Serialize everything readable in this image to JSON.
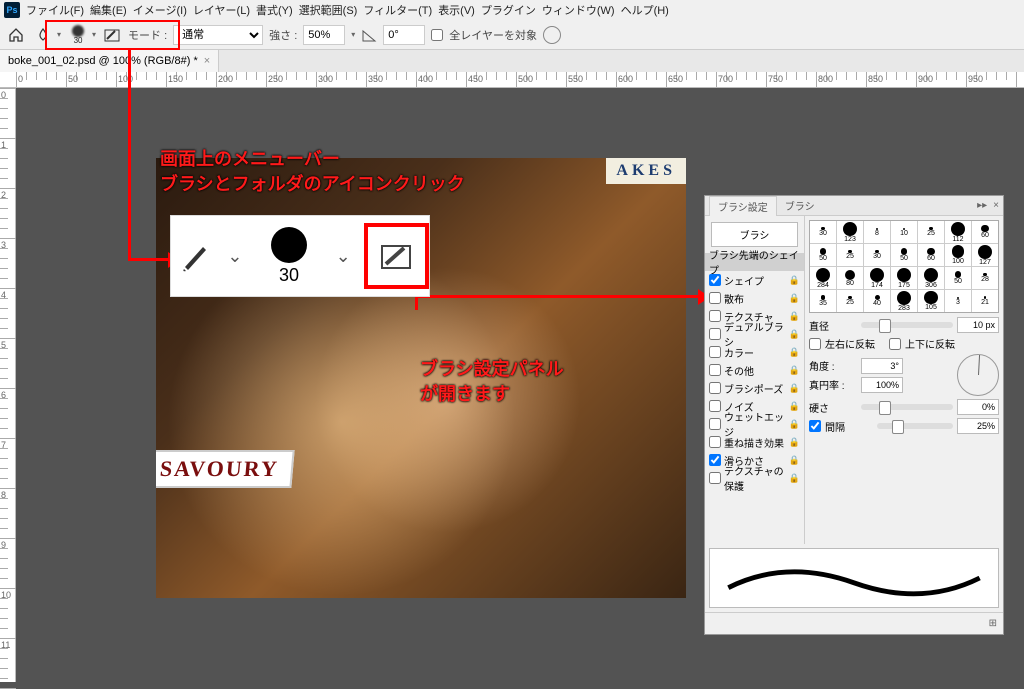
{
  "menubar": {
    "app_icon": "Ps",
    "items": [
      "ファイル(F)",
      "編集(E)",
      "イメージ(I)",
      "レイヤー(L)",
      "書式(Y)",
      "選択範囲(S)",
      "フィルター(T)",
      "表示(V)",
      "プラグイン",
      "ウィンドウ(W)",
      "ヘルプ(H)"
    ]
  },
  "options": {
    "brush_size": "30",
    "mode_label": "モード :",
    "mode_value": "通常",
    "strength_label": "強さ :",
    "strength_value": "50%",
    "angle_value": "0°",
    "all_layers_label": "全レイヤーを対象"
  },
  "tab": {
    "title": "boke_001_02.psd @ 100% (RGB/8#) *"
  },
  "ruler_labels": [
    "0",
    "50",
    "100",
    "150",
    "200",
    "250",
    "300",
    "350",
    "400",
    "450",
    "500",
    "550",
    "600",
    "650",
    "700",
    "750",
    "800",
    "850",
    "900",
    "950"
  ],
  "annotations": {
    "line1": "画面上のメニューバー",
    "line2": "ブラシとフォルダのアイコンクリック",
    "line3a": "ブラシ設定パネル",
    "line3b": "が開きます"
  },
  "enlarge": {
    "size": "30"
  },
  "canvas": {
    "sign1": "SAVOURY",
    "sign2": "AKES"
  },
  "panel": {
    "tab1": "ブラシ設定",
    "tab2": "ブラシ",
    "btn_brush": "ブラシ",
    "tip_shape": "ブラシ先端のシェイプ",
    "options": [
      {
        "label": "シェイプ",
        "checked": true,
        "lock": true
      },
      {
        "label": "散布",
        "checked": false,
        "lock": true
      },
      {
        "label": "テクスチャ",
        "checked": false,
        "lock": true
      },
      {
        "label": "デュアルブラシ",
        "checked": false,
        "lock": true
      },
      {
        "label": "カラー",
        "checked": false,
        "lock": true
      },
      {
        "label": "その他",
        "checked": false,
        "lock": true
      },
      {
        "label": "ブラシポーズ",
        "checked": false,
        "lock": true
      },
      {
        "label": "ノイズ",
        "checked": false,
        "lock": true
      },
      {
        "label": "ウェットエッジ",
        "checked": false,
        "lock": true
      },
      {
        "label": "重ね描き効果",
        "checked": false,
        "lock": true
      },
      {
        "label": "滑らかさ",
        "checked": true,
        "lock": true
      },
      {
        "label": "テクスチャの保護",
        "checked": false,
        "lock": true
      }
    ],
    "presets": [
      30,
      123,
      8,
      10,
      25,
      112,
      60,
      50,
      25,
      30,
      50,
      60,
      100,
      127,
      284,
      80,
      174,
      175,
      306,
      50,
      28,
      35,
      25,
      40,
      283,
      105,
      3,
      21
    ],
    "diameter_label": "直径",
    "diameter_value": "10 px",
    "flipx_label": "左右に反転",
    "flipy_label": "上下に反転",
    "angle_label": "角度 :",
    "angle_value": "3°",
    "roundness_label": "真円率 :",
    "roundness_value": "100%",
    "hardness_label": "硬さ",
    "hardness_value": "0%",
    "spacing_label": "間隔",
    "spacing_value": "25%"
  }
}
